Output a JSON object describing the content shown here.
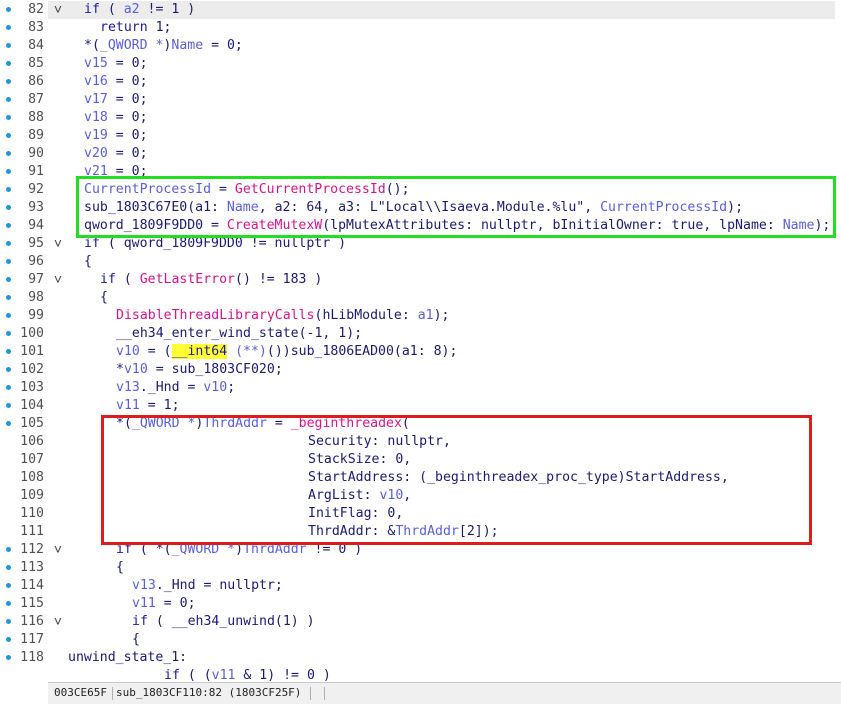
{
  "editor": {
    "lines": [
      {
        "num": "82",
        "bp": true,
        "fold": "v",
        "hl": true,
        "indent": 0,
        "tokens": [
          [
            "kw",
            "if"
          ],
          [
            "plain",
            " ( "
          ],
          [
            "var",
            "a2"
          ],
          [
            "plain",
            " != 1 )"
          ]
        ]
      },
      {
        "num": "83",
        "bp": true,
        "indent": 1,
        "tokens": [
          [
            "kw",
            "return"
          ],
          [
            "plain",
            " 1;"
          ]
        ]
      },
      {
        "num": "84",
        "bp": true,
        "indent": 0,
        "tokens": [
          [
            "plain",
            "*("
          ],
          [
            "var",
            "_QWORD *"
          ],
          [
            "plain",
            ")"
          ],
          [
            "var",
            "Name"
          ],
          [
            "plain",
            " = 0;"
          ]
        ]
      },
      {
        "num": "85",
        "bp": true,
        "indent": 0,
        "tokens": [
          [
            "var",
            "v15"
          ],
          [
            "plain",
            " = 0;"
          ]
        ]
      },
      {
        "num": "86",
        "bp": true,
        "indent": 0,
        "tokens": [
          [
            "var",
            "v16"
          ],
          [
            "plain",
            " = 0;"
          ]
        ]
      },
      {
        "num": "87",
        "bp": true,
        "indent": 0,
        "tokens": [
          [
            "var",
            "v17"
          ],
          [
            "plain",
            " = 0;"
          ]
        ]
      },
      {
        "num": "88",
        "bp": true,
        "indent": 0,
        "tokens": [
          [
            "var",
            "v18"
          ],
          [
            "plain",
            " = 0;"
          ]
        ]
      },
      {
        "num": "89",
        "bp": true,
        "indent": 0,
        "tokens": [
          [
            "var",
            "v19"
          ],
          [
            "plain",
            " = 0;"
          ]
        ]
      },
      {
        "num": "90",
        "bp": true,
        "indent": 0,
        "tokens": [
          [
            "var",
            "v20"
          ],
          [
            "plain",
            " = 0;"
          ]
        ]
      },
      {
        "num": "91",
        "bp": true,
        "indent": 0,
        "tokens": [
          [
            "var",
            "v21"
          ],
          [
            "plain",
            " = 0;"
          ]
        ]
      },
      {
        "num": "92",
        "bp": true,
        "indent": 0,
        "tokens": [
          [
            "var",
            "CurrentProcessId"
          ],
          [
            "plain",
            " = "
          ],
          [
            "fn",
            "GetCurrentProcessId"
          ],
          [
            "plain",
            "();"
          ]
        ]
      },
      {
        "num": "93",
        "bp": true,
        "indent": 0,
        "tokens": [
          [
            "plain",
            "sub_1803C67E0(a1: "
          ],
          [
            "var",
            "Name"
          ],
          [
            "plain",
            ", a2: 64, a3: L\"Local\\\\Isaeva.Module.%lu\", "
          ],
          [
            "var",
            "CurrentProcessId"
          ],
          [
            "plain",
            ");"
          ]
        ]
      },
      {
        "num": "94",
        "bp": true,
        "indent": 0,
        "tokens": [
          [
            "plain",
            "qword_1809F9DD0 = "
          ],
          [
            "fn",
            "CreateMutexW"
          ],
          [
            "plain",
            "(lpMutexAttributes: nullptr, bInitialOwner: true, lpName: "
          ],
          [
            "var",
            "Name"
          ],
          [
            "plain",
            ");"
          ]
        ]
      },
      {
        "num": "95",
        "bp": true,
        "fold": "v",
        "indent": 0,
        "tokens": [
          [
            "kw",
            "if"
          ],
          [
            "plain",
            " ( qword_1809F9DD0 != nullptr )"
          ]
        ]
      },
      {
        "num": "96",
        "bp": true,
        "indent": 0,
        "tokens": [
          [
            "plain",
            "{"
          ]
        ]
      },
      {
        "num": "97",
        "bp": true,
        "fold": "v",
        "indent": 1,
        "tokens": [
          [
            "kw",
            "if"
          ],
          [
            "plain",
            " ( "
          ],
          [
            "fn",
            "GetLastError"
          ],
          [
            "plain",
            "() != 183 )"
          ]
        ]
      },
      {
        "num": "98",
        "bp": true,
        "indent": 1,
        "tokens": [
          [
            "plain",
            "{"
          ]
        ]
      },
      {
        "num": "99",
        "bp": true,
        "indent": 2,
        "tokens": [
          [
            "fn",
            "DisableThreadLibraryCalls"
          ],
          [
            "plain",
            "(hLibModule: "
          ],
          [
            "var",
            "a1"
          ],
          [
            "plain",
            ");"
          ]
        ]
      },
      {
        "num": "100",
        "bp": true,
        "indent": 2,
        "tokens": [
          [
            "plain",
            "__eh34_enter_wind_state(-1, 1);"
          ]
        ]
      },
      {
        "num": "101",
        "bp": true,
        "indent": 2,
        "tokens": [
          [
            "var",
            "v10"
          ],
          [
            "plain",
            " = ("
          ],
          [
            "hilite",
            "__int64"
          ],
          [
            "var",
            " (**)"
          ],
          [
            "plain",
            "())sub_1806EAD00(a1: 8);"
          ]
        ]
      },
      {
        "num": "102",
        "bp": true,
        "indent": 2,
        "tokens": [
          [
            "plain",
            "*"
          ],
          [
            "var",
            "v10"
          ],
          [
            "plain",
            " = sub_1803CF020;"
          ]
        ]
      },
      {
        "num": "103",
        "bp": true,
        "indent": 2,
        "tokens": [
          [
            "var",
            "v13"
          ],
          [
            "plain",
            "._Hnd = "
          ],
          [
            "var",
            "v10"
          ],
          [
            "plain",
            ";"
          ]
        ]
      },
      {
        "num": "104",
        "bp": true,
        "indent": 2,
        "tokens": [
          [
            "var",
            "v11"
          ],
          [
            "plain",
            " = 1;"
          ]
        ]
      },
      {
        "num": "105",
        "bp": true,
        "indent": 2,
        "tokens": [
          [
            "plain",
            "*("
          ],
          [
            "var",
            "_QWORD *"
          ],
          [
            "plain",
            ")"
          ],
          [
            "var",
            "ThrdAddr"
          ],
          [
            "plain",
            " = "
          ],
          [
            "fn",
            "_beginthreadex"
          ],
          [
            "plain",
            "("
          ]
        ]
      },
      {
        "num": "106",
        "bp": false,
        "indent": 14,
        "tokens": [
          [
            "plain",
            "Security: nullptr,"
          ]
        ]
      },
      {
        "num": "107",
        "bp": false,
        "indent": 14,
        "tokens": [
          [
            "plain",
            "StackSize: 0,"
          ]
        ]
      },
      {
        "num": "108",
        "bp": false,
        "indent": 14,
        "tokens": [
          [
            "plain",
            "StartAddress: (_beginthreadex_proc_type)StartAddress,"
          ]
        ]
      },
      {
        "num": "109",
        "bp": false,
        "indent": 14,
        "tokens": [
          [
            "plain",
            "ArgList: "
          ],
          [
            "var",
            "v10"
          ],
          [
            "plain",
            ","
          ]
        ]
      },
      {
        "num": "110",
        "bp": false,
        "indent": 14,
        "tokens": [
          [
            "plain",
            "InitFlag: 0,"
          ]
        ]
      },
      {
        "num": "111",
        "bp": false,
        "indent": 14,
        "tokens": [
          [
            "plain",
            "ThrdAddr: &"
          ],
          [
            "var",
            "ThrdAddr"
          ],
          [
            "plain",
            "[2]);"
          ]
        ]
      },
      {
        "num": "112",
        "bp": true,
        "fold": "v",
        "indent": 2,
        "tokens": [
          [
            "kw",
            "if"
          ],
          [
            "plain",
            " ( *("
          ],
          [
            "var",
            "_QWORD *"
          ],
          [
            "plain",
            ")"
          ],
          [
            "var",
            "ThrdAddr"
          ],
          [
            "plain",
            " != 0 )"
          ]
        ]
      },
      {
        "num": "113",
        "bp": true,
        "indent": 2,
        "tokens": [
          [
            "plain",
            "{"
          ]
        ]
      },
      {
        "num": "114",
        "bp": true,
        "indent": 3,
        "tokens": [
          [
            "var",
            "v13"
          ],
          [
            "plain",
            "._Hnd = nullptr;"
          ]
        ]
      },
      {
        "num": "115",
        "bp": true,
        "indent": 3,
        "tokens": [
          [
            "var",
            "v11"
          ],
          [
            "plain",
            " = 0;"
          ]
        ]
      },
      {
        "num": "116",
        "bp": true,
        "fold": "v",
        "indent": 3,
        "tokens": [
          [
            "kw",
            "if"
          ],
          [
            "plain",
            " ( __eh34_unwind(1) )"
          ]
        ]
      },
      {
        "num": "117",
        "bp": true,
        "indent": 3,
        "tokens": [
          [
            "plain",
            "{"
          ]
        ]
      },
      {
        "num": "118",
        "bp": true,
        "indent": -1,
        "tokens": [
          [
            "plain",
            "unwind_state_1:"
          ]
        ]
      },
      {
        "num": "",
        "bp": false,
        "indent": 5,
        "tokens": [
          [
            "kw",
            "if"
          ],
          [
            "plain",
            " ( ("
          ],
          [
            "var",
            "v11"
          ],
          [
            "plain",
            " & 1) != 0 )"
          ]
        ]
      }
    ],
    "status_address": "003CE65F",
    "status_location": "sub_1803CF110:82 (1803CF25F)",
    "colors": {
      "green_box": "#22dd22",
      "red_box": "#e01b1b"
    }
  }
}
